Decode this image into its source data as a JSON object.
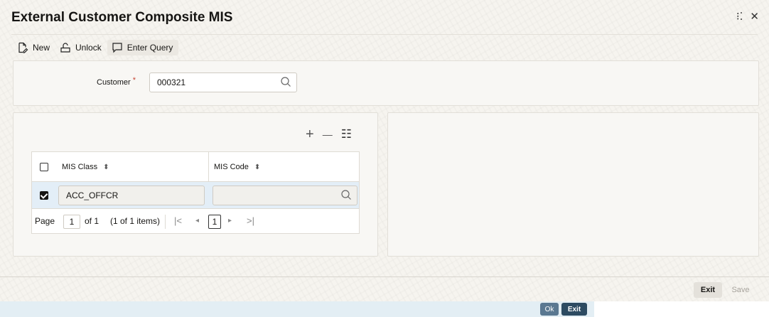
{
  "window": {
    "title": "External Customer Composite MIS",
    "maximize_icon": "⁝⁚",
    "close_icon": "✕"
  },
  "toolbar": {
    "new_label": "New",
    "unlock_label": "Unlock",
    "enter_query_label": "Enter Query"
  },
  "customer": {
    "label": "Customer",
    "required_mark": "*",
    "value": "000321"
  },
  "grid_tools": {
    "add": "+",
    "remove": "—",
    "details": "☷"
  },
  "mis_grid": {
    "columns": [
      "MIS Class",
      "MIS Code"
    ],
    "sort_icon": "⬍",
    "rows": [
      {
        "checked": true,
        "mis_class": "ACC_OFFCR",
        "mis_code": ""
      }
    ],
    "pagination": {
      "page_label": "Page",
      "current_page": "1",
      "of_text": "of 1",
      "items_text": "(1 of 1 items)",
      "first": "|<",
      "prev": "◂",
      "page_box": "1",
      "next": "▸",
      "last": ">|"
    }
  },
  "footer": {
    "exit_label": "Exit",
    "save_label": "Save"
  },
  "status_bar": {
    "ok_label": "Ok",
    "exit_label": "Exit"
  },
  "colors": {
    "accent": "#2d4b62",
    "selected_row": "#e3eef7",
    "required": "#c74634"
  }
}
